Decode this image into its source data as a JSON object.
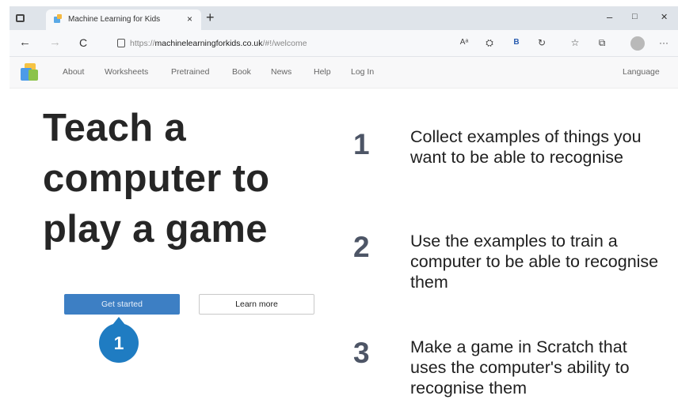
{
  "browser": {
    "tab_title": "Machine Learning for Kids",
    "tab_close": "×",
    "new_tab": "+",
    "controls": {
      "minimize": "–",
      "maximize": "□",
      "close": "✕"
    },
    "nav": {
      "back": "←",
      "forward": "→",
      "refresh": "C"
    },
    "url_prefix": "https://",
    "url_domain": "machinelearningforkids.co.uk",
    "url_path": "/#!/welcome",
    "toolbar": {
      "read_aloud": "Aᵃ",
      "more": "···",
      "bing": "B"
    }
  },
  "site": {
    "nav_items": [
      "About",
      "Worksheets",
      "Pretrained",
      "Book",
      "News",
      "Help",
      "Log In"
    ],
    "language": "Language"
  },
  "hero": {
    "headline": [
      "Teach a",
      "computer to",
      "play a game"
    ],
    "primary_button": "Get started",
    "secondary_button": "Learn more"
  },
  "steps": [
    {
      "number": "1",
      "text": "Collect examples of things you want to be able to recognise"
    },
    {
      "number": "2",
      "text": "Use the examples to train a computer to be able to recognise them"
    },
    {
      "number": "3",
      "text": "Make a game in Scratch that uses the computer's ability to recognise them"
    }
  ],
  "callout": {
    "label": "1"
  },
  "colors": {
    "primary_button": "#3d7fc4",
    "callout": "#1f7cc2",
    "step_number": "#4d5566"
  }
}
